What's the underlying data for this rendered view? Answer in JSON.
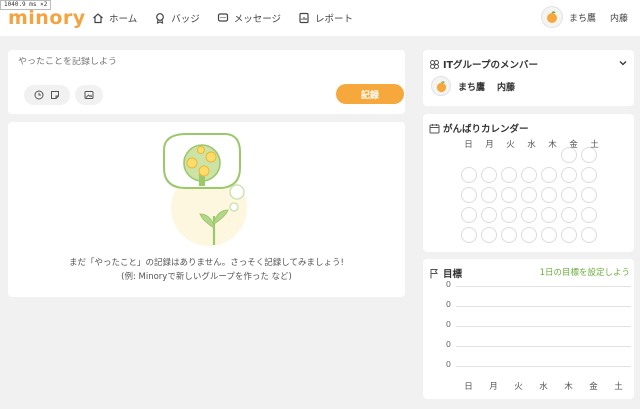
{
  "debug": {
    "fps": "1040.9 ms ×2"
  },
  "app": {
    "logo": "minory",
    "accent": "#f6a83c",
    "green": "#6cac3c"
  },
  "nav": [
    {
      "label": "ホーム",
      "icon": "home-icon"
    },
    {
      "label": "バッジ",
      "icon": "badge-icon"
    },
    {
      "label": "メッセージ",
      "icon": "message-icon"
    },
    {
      "label": "レポート",
      "icon": "report-icon"
    }
  ],
  "user": {
    "name": "まち鷹",
    "org": "内藤",
    "avatar_icon": "orange-avatar-icon"
  },
  "post": {
    "placeholder": "やったことを記録しよう",
    "tools": [
      "clock-icon",
      "sticky-note-icon",
      "image-icon"
    ],
    "record_label": "記録"
  },
  "empty": {
    "line1": "まだ「やったこと」の記録はありません。さっそく記録してみましょう!",
    "line2": "(例: Minoryで新しいグループを作った など)"
  },
  "members": {
    "title": "ITグループのメンバー",
    "list": [
      {
        "name": "まち鷹",
        "org": "内藤"
      }
    ]
  },
  "calendar": {
    "title": "がんばりカレンダー",
    "weekdays": [
      "日",
      "月",
      "火",
      "水",
      "木",
      "金",
      "土"
    ]
  },
  "goal": {
    "title": "目標",
    "link": "1日の目標を設定しよう",
    "y_values": [
      "0",
      "0",
      "0",
      "0",
      "0"
    ],
    "days": [
      "日",
      "月",
      "火",
      "水",
      "木",
      "金",
      "土"
    ]
  }
}
